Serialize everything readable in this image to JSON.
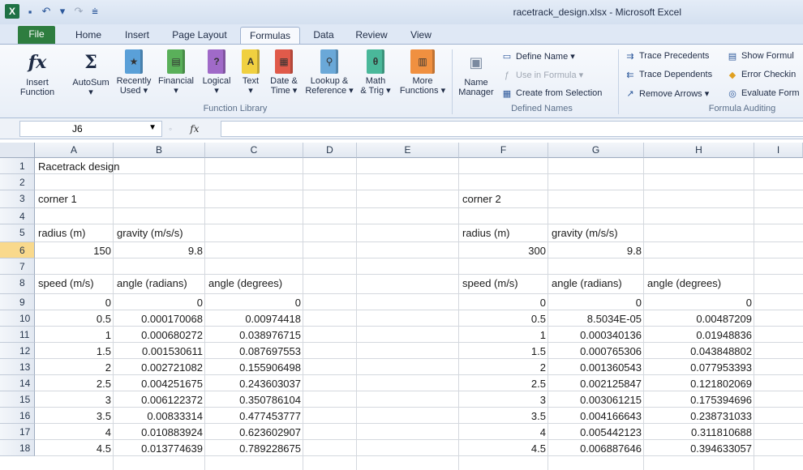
{
  "window": {
    "title": "racetrack_design.xlsx - Microsoft Excel",
    "app_icon": "X"
  },
  "tabs": [
    {
      "label": "File"
    },
    {
      "label": "Home"
    },
    {
      "label": "Insert"
    },
    {
      "label": "Page Layout"
    },
    {
      "label": "Formulas"
    },
    {
      "label": "Data"
    },
    {
      "label": "Review"
    },
    {
      "label": "View"
    }
  ],
  "ribbon": {
    "function_library": {
      "label": "Function Library",
      "buttons": [
        {
          "l1": "Insert",
          "l2": "Function",
          "icon": "fx-icon"
        },
        {
          "l1": "AutoSum",
          "l2": "▾",
          "icon": "sigma-icon"
        },
        {
          "l1": "Recently",
          "l2": "Used ▾",
          "icon": "star-book-icon"
        },
        {
          "l1": "Financial",
          "l2": "▾",
          "icon": "financial-book-icon"
        },
        {
          "l1": "Logical",
          "l2": "▾",
          "icon": "logical-book-icon"
        },
        {
          "l1": "Text",
          "l2": "▾",
          "icon": "text-book-icon"
        },
        {
          "l1": "Date &",
          "l2": "Time ▾",
          "icon": "datetime-book-icon"
        },
        {
          "l1": "Lookup &",
          "l2": "Reference ▾",
          "icon": "lookup-book-icon"
        },
        {
          "l1": "Math",
          "l2": "& Trig ▾",
          "icon": "math-book-icon"
        },
        {
          "l1": "More",
          "l2": "Functions ▾",
          "icon": "more-books-icon"
        }
      ]
    },
    "defined_names": {
      "label": "Defined Names",
      "name_manager": {
        "l1": "Name",
        "l2": "Manager"
      },
      "define_name": "Define Name ▾",
      "use_in_formula": "Use in Formula ▾",
      "create_from_selection": "Create from Selection"
    },
    "formula_auditing": {
      "label": "Formula Auditing",
      "trace_precedents": "Trace Precedents",
      "trace_dependents": "Trace Dependents",
      "remove_arrows": "Remove Arrows ▾",
      "show_formulas": "Show Formul",
      "error_checking": "Error Checkin",
      "evaluate_formula": "Evaluate Form"
    }
  },
  "formula_bar": {
    "name_box": "J6",
    "fx": "fx",
    "formula": ""
  },
  "columns": [
    "A",
    "B",
    "C",
    "D",
    "E",
    "F",
    "G",
    "H",
    "I"
  ],
  "rows": [
    "1",
    "2",
    "3",
    "4",
    "5",
    "6",
    "7",
    "8",
    "9",
    "10",
    "11",
    "12",
    "13",
    "14",
    "15",
    "16",
    "17",
    "18"
  ],
  "cells": {
    "A1": "Racetrack design",
    "A3": "corner 1",
    "F3": "corner 2",
    "A5": "radius (m)",
    "B5": "gravity (m/s/s)",
    "F5": "radius (m)",
    "G5": "gravity (m/s/s)",
    "A6": "150",
    "B6": "9.8",
    "F6": "300",
    "G6": "9.8",
    "A8": "speed (m/s)",
    "B8": "angle (radians)",
    "C8": "angle (degrees)",
    "F8": "speed (m/s)",
    "G8": "angle (radians)",
    "H8": "angle (degrees)"
  },
  "table1": [
    [
      "0",
      "0",
      "0"
    ],
    [
      "0.5",
      "0.000170068",
      "0.00974418"
    ],
    [
      "1",
      "0.000680272",
      "0.038976715"
    ],
    [
      "1.5",
      "0.001530611",
      "0.087697553"
    ],
    [
      "2",
      "0.002721082",
      "0.155906498"
    ],
    [
      "2.5",
      "0.004251675",
      "0.243603037"
    ],
    [
      "3",
      "0.006122372",
      "0.350786104"
    ],
    [
      "3.5",
      "0.00833314",
      "0.477453777"
    ],
    [
      "4",
      "0.010883924",
      "0.623602907"
    ],
    [
      "4.5",
      "0.013774639",
      "0.789228675"
    ]
  ],
  "table2": [
    [
      "0",
      "0",
      "0"
    ],
    [
      "0.5",
      "8.5034E-05",
      "0.00487209"
    ],
    [
      "1",
      "0.000340136",
      "0.01948836"
    ],
    [
      "1.5",
      "0.000765306",
      "0.043848802"
    ],
    [
      "2",
      "0.001360543",
      "0.077953393"
    ],
    [
      "2.5",
      "0.002125847",
      "0.121802069"
    ],
    [
      "3",
      "0.003061215",
      "0.175394696"
    ],
    [
      "3.5",
      "0.004166643",
      "0.238731033"
    ],
    [
      "4",
      "0.005442123",
      "0.311810688"
    ],
    [
      "4.5",
      "0.006887646",
      "0.394633057"
    ]
  ],
  "colors": {
    "file_tab": "#2e7d3f",
    "selected_row_header": "#f9d98c",
    "ribbon_group_label": "#5b6f8a"
  }
}
